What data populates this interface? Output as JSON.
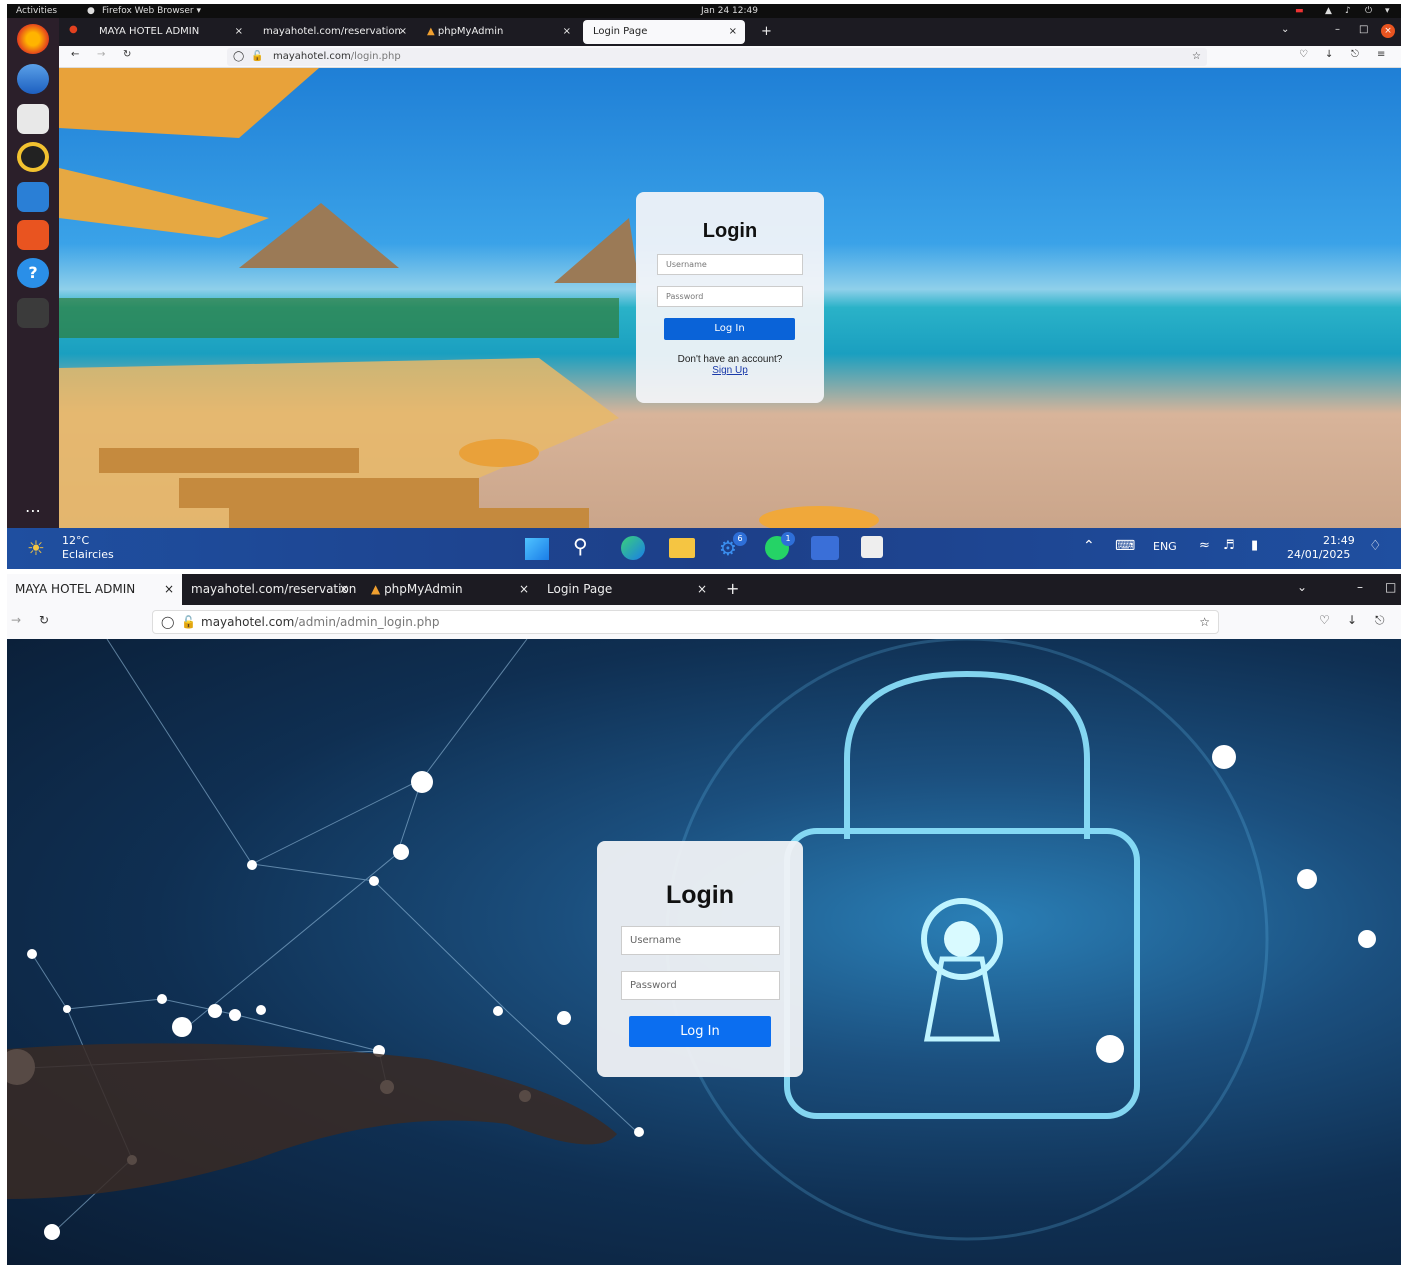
{
  "top": {
    "gnome": {
      "activities": "Activities",
      "app": "Firefox Web Browser ▾",
      "clock": "Jan 24  12:49"
    },
    "tabs": [
      {
        "label": "MAYA HOTEL ADMIN",
        "close": "×"
      },
      {
        "label": "mayahotel.com/reservation",
        "close": "×"
      },
      {
        "label": "phpMyAdmin",
        "close": "×"
      },
      {
        "label": "Login Page",
        "close": "×"
      }
    ],
    "new_tab": "+",
    "url": {
      "domain": "mayahotel.com",
      "path": "/login.php"
    },
    "login": {
      "title": "Login",
      "username_placeholder": "Username",
      "password_placeholder": "Password",
      "button": "Log In",
      "no_account": "Don't have an account?",
      "signup": "Sign Up"
    },
    "taskbar": {
      "temp": "12°C",
      "weather": "Eclaircies",
      "lang": "ENG",
      "time": "21:49",
      "date": "24/01/2025",
      "badge1": "6",
      "badge2": "1"
    }
  },
  "bottom": {
    "tabs": [
      {
        "label": "MAYA HOTEL ADMIN",
        "close": "×"
      },
      {
        "label": "mayahotel.com/reservation",
        "close": "×"
      },
      {
        "label": "phpMyAdmin",
        "close": "×"
      },
      {
        "label": "Login Page",
        "close": "×"
      }
    ],
    "new_tab": "+",
    "url": {
      "domain": "mayahotel.com",
      "path": "/admin/admin_login.php"
    },
    "login": {
      "title": "Login",
      "username_placeholder": "Username",
      "password_placeholder": "Password",
      "button": "Log In"
    }
  }
}
